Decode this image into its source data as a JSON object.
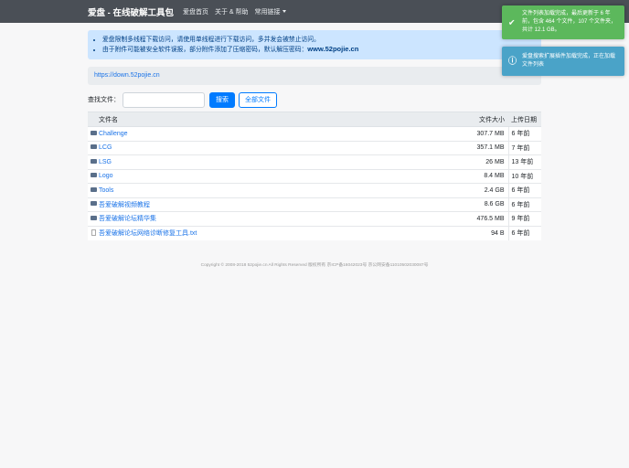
{
  "nav": {
    "brand": "爱盘 - 在线破解工具包",
    "links": [
      "爱盘首页",
      "关于 & 帮助",
      "常用链接"
    ]
  },
  "alert": {
    "items": [
      "爱盘限制多线程下载访问，请使用单线程进行下载访问，多并发会被禁止访问。",
      "由于附件可能被安全软件误报，部分附件添加了压缩密码，默认解压密码："
    ],
    "password": "www.52pojie.cn"
  },
  "path": "https://down.52pojie.cn",
  "search": {
    "label": "查找文件：",
    "value": "",
    "search_button": "搜索",
    "all_button": "全部文件"
  },
  "table": {
    "headers": [
      "文件名",
      "文件大小",
      "上传日期"
    ],
    "rows": [
      {
        "name": "Challenge",
        "size": "307.7 MB",
        "date": "6 年前",
        "type": "folder"
      },
      {
        "name": "LCG",
        "size": "357.1 MB",
        "date": "7 年前",
        "type": "folder"
      },
      {
        "name": "LSG",
        "size": "26 MB",
        "date": "13 年前",
        "type": "folder"
      },
      {
        "name": "Logo",
        "size": "8.4 MB",
        "date": "10 年前",
        "type": "folder"
      },
      {
        "name": "Tools",
        "size": "2.4 GB",
        "date": "6 年前",
        "type": "folder"
      },
      {
        "name": "吾爱破解视频教程",
        "size": "8.6 GB",
        "date": "6 年前",
        "type": "folder"
      },
      {
        "name": "吾爱破解论坛精华集",
        "size": "476.5 MB",
        "date": "9 年前",
        "type": "folder"
      },
      {
        "name": "吾爱破解论坛网络诊断修复工具.txt",
        "size": "94 B",
        "date": "6 年前",
        "type": "file"
      }
    ]
  },
  "footer": "Copyright © 2008-2018 52pojie.cn All Rights Reserved 版权所有 京ICP备16042023号 京公网安备11010502030087号",
  "toasts": [
    {
      "text": "文件列表加载完成，最后更新于 6 年前，包含 464 个文件，107 个文件夹，共计 12.1 GB。",
      "icon": "check-icon",
      "color": "#5cb85c"
    },
    {
      "text": "爱盘搜索扩展插件加载完成，正在加载文件列表",
      "icon": "info-icon",
      "color": "#4aa3c8"
    }
  ]
}
